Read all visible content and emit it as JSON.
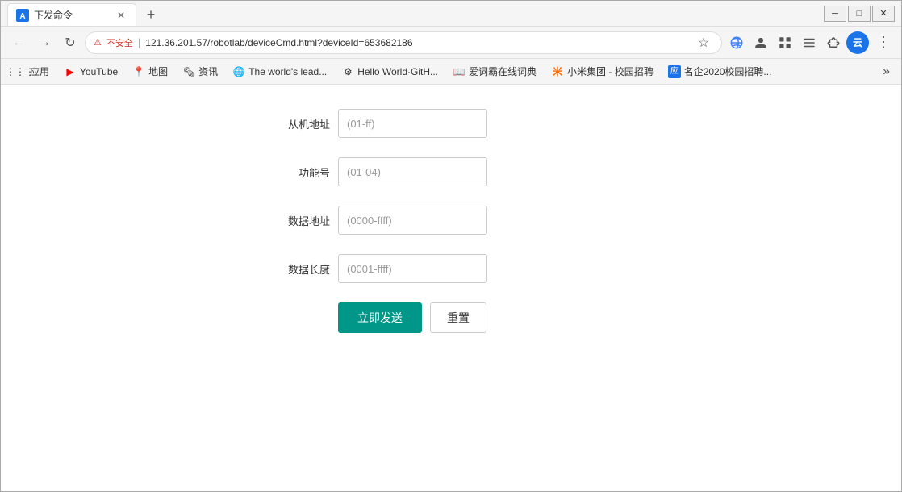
{
  "window": {
    "title": "下发命令",
    "controls": {
      "minimize": "─",
      "restore": "□",
      "close": "✕"
    }
  },
  "nav": {
    "back_title": "后退",
    "forward_title": "前进",
    "refresh_title": "刷新",
    "insecure_label": "不安全",
    "url": "121.36.201.57/robotlab/deviceCmd.html?deviceId=653682186",
    "full_url": "121.36.201.57/robotlab/deviceCmd.html?deviceId=653682186"
  },
  "bookmarks": [
    {
      "id": "apps",
      "label": "应用",
      "icon": "⋮⋮⋮"
    },
    {
      "id": "youtube",
      "label": "YouTube",
      "icon": "▶"
    },
    {
      "id": "maps",
      "label": "地图",
      "icon": "📍"
    },
    {
      "id": "news",
      "label": "资讯",
      "icon": "🗞"
    },
    {
      "id": "theworld",
      "label": "The world's lead...",
      "icon": "🌐"
    },
    {
      "id": "github",
      "label": "Hello World·GitH...",
      "icon": "⚙"
    },
    {
      "id": "dict",
      "label": "爱词霸在线词典",
      "icon": "📖"
    },
    {
      "id": "xiaomi",
      "label": "小米集团 - 校园招聘",
      "icon": "米"
    },
    {
      "id": "jobs",
      "label": "名企2020校园招聘...",
      "icon": "应"
    }
  ],
  "form": {
    "fields": [
      {
        "id": "from-addr",
        "label": "从机地址",
        "placeholder": "(01-ff)"
      },
      {
        "id": "func-num",
        "label": "功能号",
        "placeholder": "(01-04)"
      },
      {
        "id": "data-addr",
        "label": "数据地址",
        "placeholder": "(0000-ffff)"
      },
      {
        "id": "data-len",
        "label": "数据长度",
        "placeholder": "(0001-ffff)"
      }
    ],
    "send_btn": "立即发送",
    "reset_btn": "重置"
  }
}
